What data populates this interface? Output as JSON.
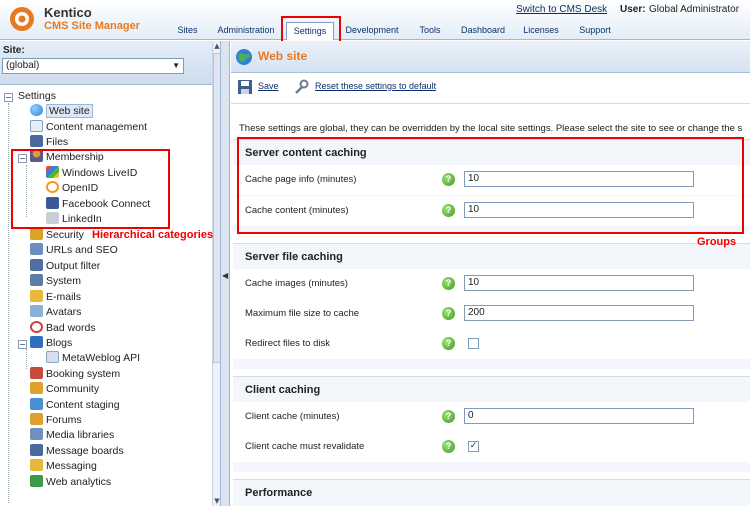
{
  "header": {
    "logo_line1": "Kentico",
    "logo_line2": "CMS Site Manager",
    "switch_link": "Switch to CMS Desk",
    "user_label": "User:",
    "user_name": "Global Administrator",
    "tabs": [
      {
        "label": "Sites"
      },
      {
        "label": "Administration"
      },
      {
        "label": "Settings"
      },
      {
        "label": "Development"
      },
      {
        "label": "Tools"
      },
      {
        "label": "Dashboard"
      },
      {
        "label": "Licenses"
      },
      {
        "label": "Support"
      }
    ],
    "active_tab": "Settings"
  },
  "sidebar": {
    "site_label": "Site:",
    "site_value": "(global)",
    "tree": {
      "root": "Settings",
      "items": [
        {
          "label": "Web site",
          "icon": "globe-icon",
          "color": "#2f7fd6"
        },
        {
          "label": "Content management",
          "icon": "document-icon",
          "color": "#7da3c9"
        },
        {
          "label": "Files",
          "icon": "floppy-icon",
          "color": "#4a6a9a"
        },
        {
          "label": "Membership",
          "icon": "user-icon",
          "color": "#e0a030"
        },
        {
          "label": "Windows LiveID",
          "icon": "windows-icon",
          "color": "#3b7ed6"
        },
        {
          "label": "OpenID",
          "icon": "openid-icon",
          "color": "#f29a1e"
        },
        {
          "label": "Facebook Connect",
          "icon": "facebook-icon",
          "color": "#3b5998"
        },
        {
          "label": "LinkedIn",
          "icon": "linkedin-icon",
          "color": "#b0b8c4"
        },
        {
          "label": "Security",
          "icon": "lock-icon",
          "color": "#d9a424"
        },
        {
          "label": "URLs and SEO",
          "icon": "link-icon",
          "color": "#6a8fbf"
        },
        {
          "label": "Output filter",
          "icon": "filter-icon",
          "color": "#4f6f9f"
        },
        {
          "label": "System",
          "icon": "computer-icon",
          "color": "#5b7da8"
        },
        {
          "label": "E-mails",
          "icon": "mail-icon",
          "color": "#e8b83a"
        },
        {
          "label": "Avatars",
          "icon": "avatar-icon",
          "color": "#8bb0d8"
        },
        {
          "label": "Bad words",
          "icon": "bad-words-icon",
          "color": "#d04040"
        },
        {
          "label": "Blogs",
          "icon": "blog-icon",
          "color": "#2f6fbf"
        },
        {
          "label": "MetaWeblog API",
          "icon": "api-icon",
          "color": "#8aa4c4"
        },
        {
          "label": "Booking system",
          "icon": "calendar-icon",
          "color": "#c84a3a"
        },
        {
          "label": "Community",
          "icon": "community-icon",
          "color": "#e0a030"
        },
        {
          "label": "Content staging",
          "icon": "staging-icon",
          "color": "#4a8fd0"
        },
        {
          "label": "Forums",
          "icon": "forum-icon",
          "color": "#e0a030"
        },
        {
          "label": "Media libraries",
          "icon": "media-icon",
          "color": "#7090c0"
        },
        {
          "label": "Message boards",
          "icon": "board-icon",
          "color": "#4a6a9a"
        },
        {
          "label": "Messaging",
          "icon": "message-icon",
          "color": "#e8b83a"
        },
        {
          "label": "Web analytics",
          "icon": "analytics-icon",
          "color": "#3a9a4a"
        }
      ]
    },
    "annotation": "Hierarchical categories"
  },
  "main": {
    "title": "Web site",
    "toolbar": {
      "save_label": "Save",
      "reset_label": "Reset these settings to default"
    },
    "intro": "These settings are global, they can be overridden by the local site settings. Please select the site to see or change the s",
    "groups_annotation": "Groups",
    "groups": [
      {
        "title": "Server content caching",
        "rows": [
          {
            "label": "Cache page info (minutes)",
            "type": "text",
            "value": "10"
          },
          {
            "label": "Cache content (minutes)",
            "type": "text",
            "value": "10"
          }
        ]
      },
      {
        "title": "Server file caching",
        "rows": [
          {
            "label": "Cache images (minutes)",
            "type": "text",
            "value": "10"
          },
          {
            "label": "Maximum file size to cache",
            "type": "text",
            "value": "200"
          },
          {
            "label": "Redirect files to disk",
            "type": "checkbox",
            "value": ""
          }
        ]
      },
      {
        "title": "Client caching",
        "rows": [
          {
            "label": "Client cache (minutes)",
            "type": "text",
            "value": "0"
          },
          {
            "label": "Client cache must revalidate",
            "type": "checkbox",
            "value": "✓"
          }
        ]
      },
      {
        "title": "Performance",
        "rows": []
      }
    ]
  },
  "colors": {
    "accent_orange": "#e87a1e",
    "link_blue": "#0b2f6b",
    "annotation_red": "#e00000"
  }
}
